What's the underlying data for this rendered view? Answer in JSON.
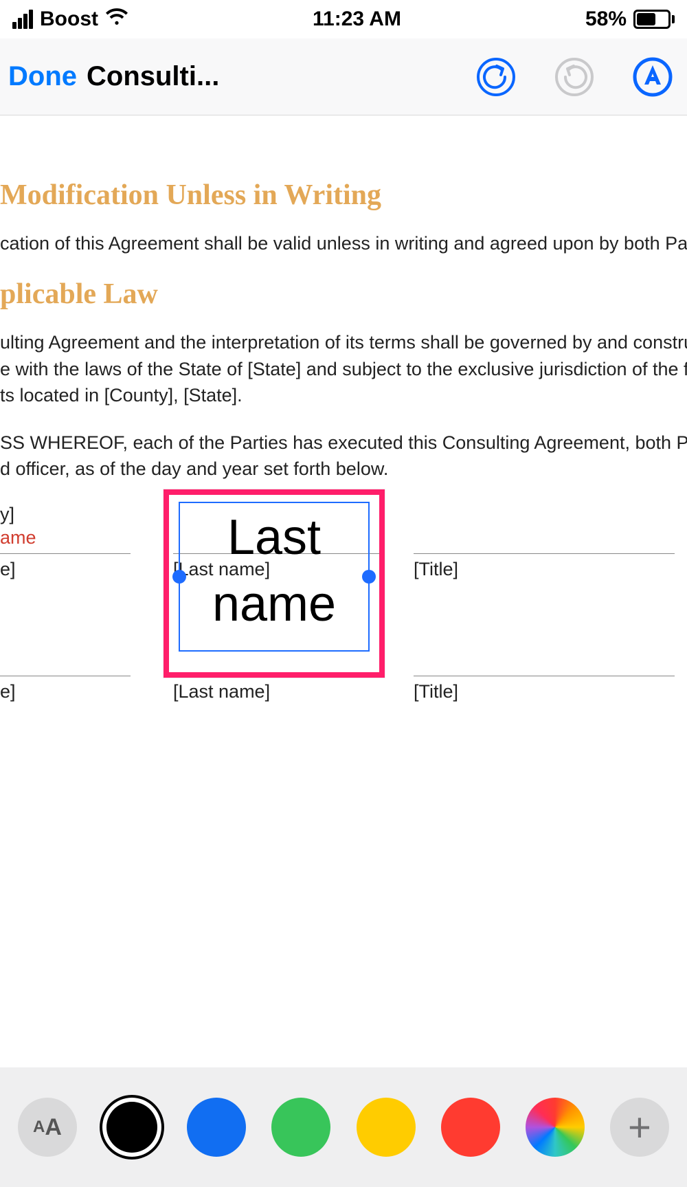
{
  "status": {
    "carrier": "Boost",
    "time": "11:23 AM",
    "battery_pct": "58%"
  },
  "toolbar": {
    "done_label": "Done",
    "doc_title": "Consulti..."
  },
  "doc": {
    "heading1": "Modification Unless in Writing",
    "para1": "cation of this Agreement shall be valid unless in writing and agreed upon by both Partie",
    "heading2": "plicable Law",
    "para2a": "ulting Agreement and the interpretation of its terms shall be governed by and construed",
    "para2b": "e with the laws of the State of [State] and subject to the exclusive jurisdiction of the fed",
    "para2c": "ts located in [County], [State].",
    "para3a": "SS WHEREOF, each of the Parties has executed this Consulting Agreement, both Parties",
    "para3b": "d officer, as of the day and year set forth below.",
    "row_bracketY": "y]",
    "row_ame": "ame",
    "field_e": "e]",
    "field_lastname": "[Last name]",
    "field_title": "[Title]",
    "textbox_content": "Last name"
  },
  "colors": {
    "black": "#000000",
    "blue": "#116ef2",
    "green": "#38c55a",
    "yellow": "#ffcc00",
    "red": "#ff3b30"
  },
  "bottom": {
    "aa_small": "A",
    "aa_big": "A",
    "plus": "+"
  }
}
